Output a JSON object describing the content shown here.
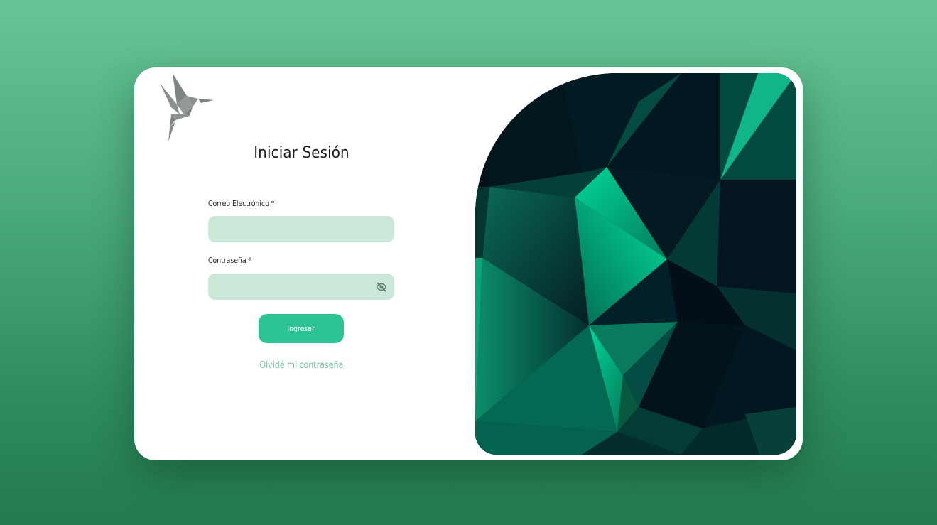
{
  "login": {
    "title": "Iniciar Sesión",
    "email_label": "Correo Electrónico *",
    "email_value": "",
    "email_placeholder": "",
    "password_label": "Contraseña *",
    "password_value": "",
    "password_placeholder": "",
    "submit_label": "Ingresar",
    "forgot_label": "Olvidé mi contraseña"
  },
  "icons": {
    "logo": "hummingbird-origami-logo",
    "password_toggle": "eye-off-icon"
  },
  "colors": {
    "background_top": "#68c497",
    "background_bottom": "#237a50",
    "input_fill": "#cbe7d8",
    "button": "#2cc497",
    "link": "#72c29b",
    "logo": "#858b88"
  }
}
